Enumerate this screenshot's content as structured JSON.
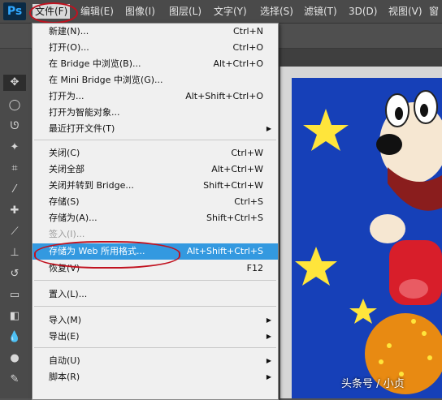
{
  "app": {
    "logo": "Ps"
  },
  "menubar": {
    "items": [
      "文件(F)",
      "编辑(E)",
      "图像(I)",
      "图层(L)",
      "文字(Y)",
      "选择(S)",
      "滤镜(T)",
      "3D(D)",
      "视图(V)",
      "窗"
    ]
  },
  "file_menu": {
    "items": [
      {
        "label": "新建(N)...",
        "shortcut": "Ctrl+N"
      },
      {
        "label": "打开(O)...",
        "shortcut": "Ctrl+O"
      },
      {
        "label": "在 Bridge 中浏览(B)...",
        "shortcut": "Alt+Ctrl+O"
      },
      {
        "label": "在 Mini Bridge 中浏览(G)...",
        "shortcut": ""
      },
      {
        "label": "打开为...",
        "shortcut": "Alt+Shift+Ctrl+O"
      },
      {
        "label": "打开为智能对象...",
        "shortcut": ""
      },
      {
        "label": "最近打开文件(T)",
        "shortcut": "",
        "submenu": true
      },
      {
        "label": "关闭(C)",
        "shortcut": "Ctrl+W"
      },
      {
        "label": "关闭全部",
        "shortcut": "Alt+Ctrl+W"
      },
      {
        "label": "关闭并转到 Bridge...",
        "shortcut": "Shift+Ctrl+W"
      },
      {
        "label": "存储(S)",
        "shortcut": "Ctrl+S"
      },
      {
        "label": "存储为(A)...",
        "shortcut": "Shift+Ctrl+S"
      },
      {
        "label": "签入(I)...",
        "shortcut": "",
        "disabled": true
      },
      {
        "label": "存储为 Web 所用格式...",
        "shortcut": "Alt+Shift+Ctrl+S",
        "highlighted": true
      },
      {
        "label": "恢复(V)",
        "shortcut": "F12"
      },
      {
        "label": "置入(L)...",
        "shortcut": ""
      },
      {
        "label": "导入(M)",
        "shortcut": "",
        "submenu": true
      },
      {
        "label": "导出(E)",
        "shortcut": "",
        "submenu": true
      },
      {
        "label": "自动(U)",
        "shortcut": "",
        "submenu": true
      },
      {
        "label": "脚本(R)",
        "shortcut": "",
        "submenu": true
      }
    ]
  },
  "watermark": "头条号 / 小贞",
  "colors": {
    "highlight": "#3399e0",
    "annotation": "#c1121f",
    "canvas_bg": "#0d3aa8"
  }
}
